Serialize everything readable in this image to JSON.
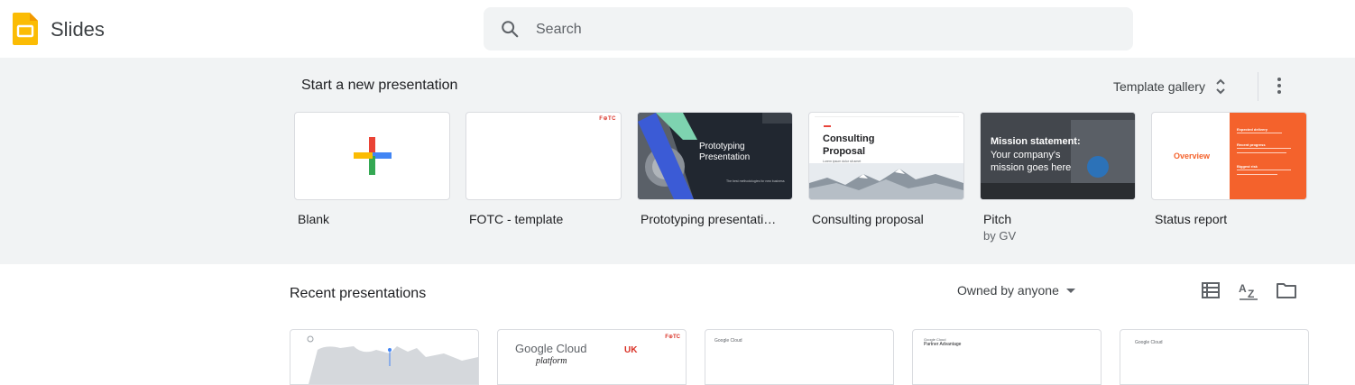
{
  "header": {
    "app_name": "Slides",
    "search_placeholder": "Search"
  },
  "templates": {
    "title": "Start a new presentation",
    "gallery_label": "Template gallery",
    "items": [
      {
        "label": "Blank",
        "sub": ""
      },
      {
        "label": "FOTC - template",
        "sub": "",
        "badge": "F⊕TC"
      },
      {
        "label": "Prototyping presentati…",
        "sub": "",
        "thumb_title": "Prototyping Presentation",
        "thumb_caption": "The best methodologies for new business"
      },
      {
        "label": "Consulting proposal",
        "sub": "",
        "thumb_title": "Consulting Proposal",
        "thumb_caption": "Lorem ipsum dolor sit amet"
      },
      {
        "label": "Pitch",
        "sub": "by GV",
        "thumb_title": "Mission statement:",
        "thumb_body": "Your company's mission goes here"
      },
      {
        "label": "Status report",
        "sub": "",
        "thumb_title": "Overview",
        "thumb_side": [
          "Expected delivery",
          "Recent progress",
          "Biggest risk"
        ]
      }
    ]
  },
  "recent": {
    "title": "Recent presentations",
    "owner_filter": "Owned by anyone",
    "cards": [
      {
        "text": ""
      },
      {
        "text": "Google Cloud",
        "sub": "platform",
        "tag": "UK",
        "badge": "F⊕TC"
      },
      {
        "text": "Google Cloud"
      },
      {
        "text": "Partner Advantage",
        "sub": "Google Cloud"
      },
      {
        "text": "Google Cloud"
      }
    ]
  },
  "colors": {
    "accent_blue": "#4285f4",
    "accent_red": "#ea4335",
    "accent_yellow": "#fbbc04",
    "accent_green": "#34a853",
    "status_orange": "#f4622c"
  },
  "icons": [
    "slides-logo-icon",
    "search-icon",
    "unfold-icon",
    "more-vert-icon",
    "list-view-icon",
    "sort-az-icon",
    "folder-icon",
    "plus-icon"
  ]
}
